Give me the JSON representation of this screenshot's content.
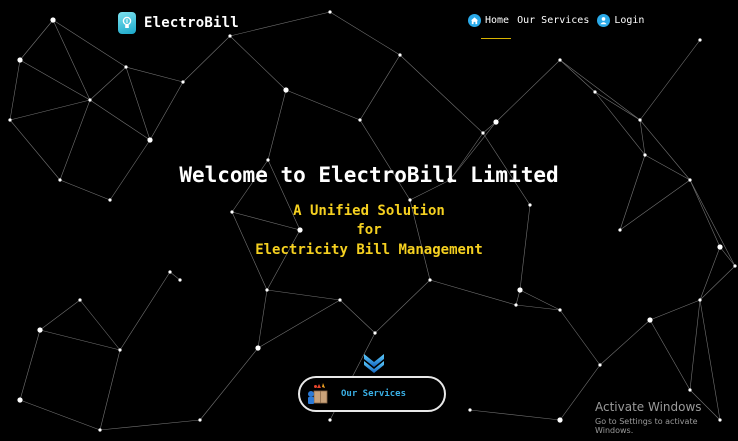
{
  "brand": {
    "name": "ElectroBill",
    "logo_icon": "lightbulb-icon"
  },
  "nav": {
    "items": [
      {
        "label": "Home",
        "icon": "home-icon",
        "active": true
      },
      {
        "label": "Our Services"
      },
      {
        "label": "Login",
        "icon": "user-icon"
      }
    ],
    "active_underline_color": "#d8b400"
  },
  "hero": {
    "title": "Welcome to ElectroBill Limited",
    "subtitle_lines": [
      "A Unified Solution",
      "for",
      "Electricity Bill Management"
    ],
    "subtitle_color": "#f5d020"
  },
  "scroll_icon": "double-chevron-down-icon",
  "services_button": {
    "label": "Our Services",
    "icon": "delivery-box-icon"
  },
  "watermark": {
    "line1": "Activate Windows",
    "line2": "Go to Settings to activate Windows."
  },
  "colors": {
    "background": "#000000",
    "accent": "#2aa9e8",
    "network": "#ffffff"
  }
}
